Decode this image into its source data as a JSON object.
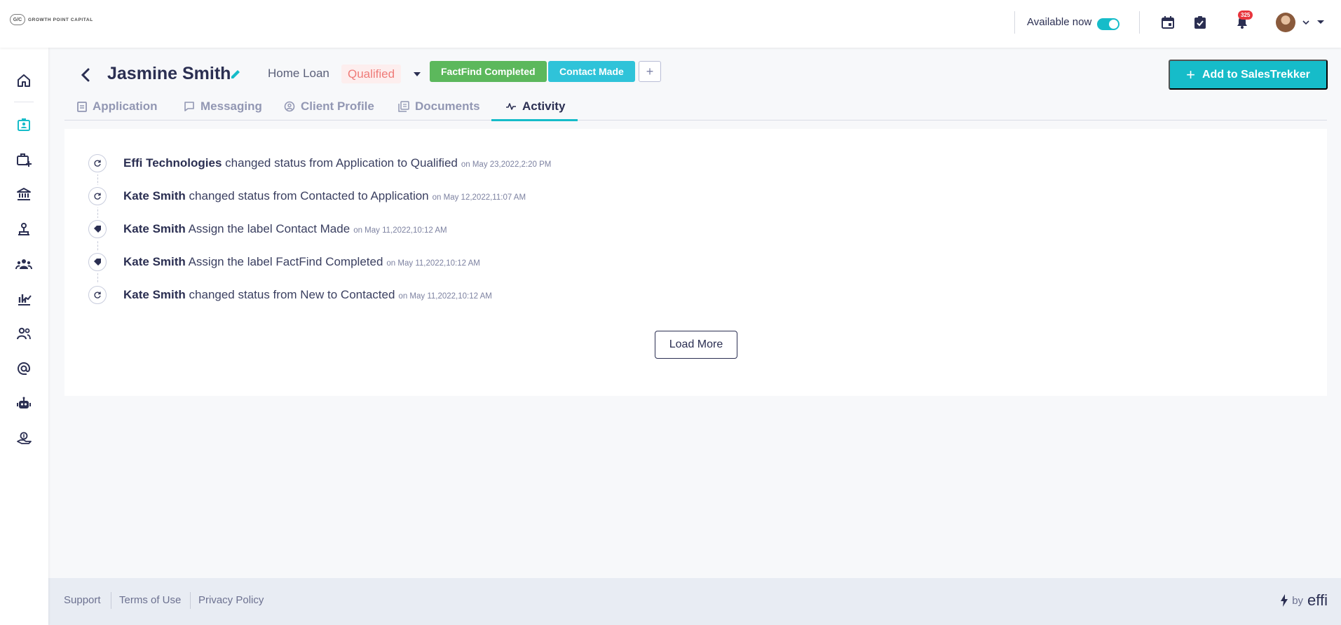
{
  "brand": {
    "logo_mark": "G/C",
    "logo_text": "GROWTH POINT CAPITAL",
    "footer_by": "by",
    "footer_name": "effi"
  },
  "topbar": {
    "availability_label": "Available now",
    "availability_on": true,
    "notification_count": "325",
    "icons": [
      "calendar-icon",
      "task-check-icon",
      "bell-icon",
      "avatar",
      "chevron-down-icon",
      "caret-down-icon"
    ]
  },
  "sidebar": {
    "items": [
      {
        "icon": "home-icon",
        "active": false
      },
      {
        "icon": "leads-icon",
        "active": true
      },
      {
        "icon": "briefcase-add-icon",
        "active": false
      },
      {
        "icon": "bank-icon",
        "active": false
      },
      {
        "icon": "network-icon",
        "active": false
      },
      {
        "icon": "team-icon",
        "active": false
      },
      {
        "icon": "analytics-icon",
        "active": false
      },
      {
        "icon": "contacts-icon",
        "active": false
      },
      {
        "icon": "at-sign-icon",
        "active": false
      },
      {
        "icon": "robot-icon",
        "active": false
      },
      {
        "icon": "money-hand-icon",
        "active": false
      }
    ]
  },
  "header": {
    "client_name": "Jasmine Smith",
    "loan_type": "Home Loan",
    "status": "Qualified",
    "labels": [
      "FactFind Completed",
      "Contact Made"
    ],
    "add_label": "+",
    "cta": "Add to SalesTrekker",
    "cta_icon": "+"
  },
  "tabs": [
    {
      "label": "Application",
      "icon": "clipboard-icon",
      "active": false
    },
    {
      "label": "Messaging",
      "icon": "message-icon",
      "active": false
    },
    {
      "label": "Client Profile",
      "icon": "user-circle-icon",
      "active": false
    },
    {
      "label": "Documents",
      "icon": "documents-icon",
      "active": false
    },
    {
      "label": "Activity",
      "icon": "activity-icon",
      "active": true
    }
  ],
  "activity": {
    "items": [
      {
        "actor": "Effi Technologies",
        "action": "changed status from Application to Qualified",
        "date": "on May 23,2022,2:20 PM",
        "icon": "refresh-icon"
      },
      {
        "actor": "Kate Smith",
        "action": "changed status from Contacted to Application",
        "date": "on May 12,2022,11:07 AM",
        "icon": "refresh-icon"
      },
      {
        "actor": "Kate Smith",
        "action": "Assign the label Contact Made",
        "date": "on May 11,2022,10:12 AM",
        "icon": "tag-icon"
      },
      {
        "actor": "Kate Smith",
        "action": "Assign the label FactFind Completed",
        "date": "on May 11,2022,10:12 AM",
        "icon": "tag-icon"
      },
      {
        "actor": "Kate Smith",
        "action": "changed status from New to Contacted",
        "date": "on May 11,2022,10:12 AM",
        "icon": "refresh-icon"
      }
    ],
    "load_more": "Load More"
  },
  "footer": {
    "links": [
      "Support",
      "Terms of Use",
      "Privacy Policy"
    ]
  },
  "colors": {
    "accent": "#16bcc9",
    "primary_text": "#2b2f52",
    "status_text": "#ef7b78",
    "status_bg": "#fdeeee",
    "label_green": "#5cb85c",
    "label_cyan": "#2fc3d9",
    "badge_red": "#e8353d"
  }
}
